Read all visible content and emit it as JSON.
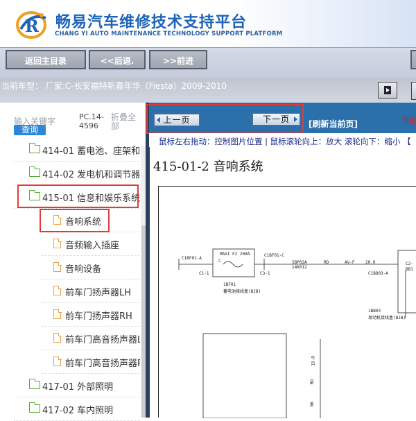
{
  "header": {
    "title": "畅易汽车维修技术支持平台",
    "subtitle": "CHANG YI AUTO MAINTENANCE TECHNOLOGY SUPPORT PLATFORM"
  },
  "nav": {
    "home": "返回主目录",
    "back": "<<后退.",
    "forward": ">>前进"
  },
  "vehicle": {
    "text": "当前车型： 厂家:C-长安福特新嘉年华（Fiesta）2009-2010"
  },
  "sidebar": {
    "keyword_placeholder": "输入关键字",
    "search": "查询",
    "pc_code": "PC.14-4596",
    "collapse_all": "折叠全部",
    "items": [
      {
        "label": "414-01 蓄电池、座架和电",
        "type": "folder"
      },
      {
        "label": "414-02 发电机和调节器",
        "type": "folder"
      },
      {
        "label": "415-01 信息和娱乐系统",
        "type": "folder-open"
      },
      {
        "label": "音响系统",
        "type": "doc"
      },
      {
        "label": "音频输入插座",
        "type": "doc"
      },
      {
        "label": "音响设备",
        "type": "doc"
      },
      {
        "label": "前车门扬声器LH",
        "type": "doc"
      },
      {
        "label": "前车门扬声器RH",
        "type": "doc"
      },
      {
        "label": "前车门高音扬声器LH",
        "type": "doc"
      },
      {
        "label": "前车门高音扬声器RH",
        "type": "doc"
      },
      {
        "label": "417-01 外部照明",
        "type": "folder"
      },
      {
        "label": "417-02 车内照明",
        "type": "folder"
      }
    ]
  },
  "viewer": {
    "prev": "上一页",
    "next": "下一页",
    "refresh": "[刷新当前页]",
    "current_page": "当前",
    "hint": "鼠标左右拖动：控制图片位置 | 鼠标滚轮向上：放大  滚轮向下：缩小 【",
    "doc_title": "415-01-2 音响系统"
  },
  "diagram": {
    "labels": {
      "c1bf01a": "C1BF01-A",
      "c11": "C1-1",
      "maxi": "MAXI F2 200A",
      "maxi_c": "C",
      "c1bf01c": "C1BF01-C",
      "c31": "C3-1",
      "sbp02a": "SBP02A",
      "code14": "14K012",
      "rd": "RD",
      "avf": "AV-F",
      "val20": "20.0",
      "c1bd03": "C1BD03-A",
      "bp01": "1BF01",
      "bp01desc": "蓄电池接线盒(BJB)",
      "bb03": "1BB03",
      "bb03desc": "发动机接线盒(BJB)",
      "c2": "C2-",
      "bb": "BB1",
      "v15": "15.0",
      "rd2": "RD",
      "bk": "BK"
    }
  }
}
